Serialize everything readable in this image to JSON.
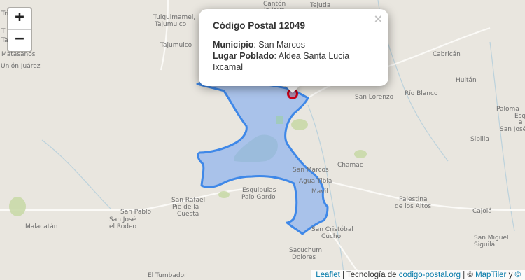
{
  "zoom": {
    "in_label": "+",
    "out_label": "−"
  },
  "popup": {
    "close_label": "×",
    "title": "Código Postal 12049",
    "municipio_label": "Municipio",
    "municipio_value": "San Marcos",
    "lugar_label": "Lugar Poblado",
    "lugar_value": "Aldea Santa Lucia Ixcamal"
  },
  "attribution": {
    "leaflet": "Leaflet",
    "sep": " | Tecnología de ",
    "site": "codigo-postal.org",
    "sep2": " | © ",
    "maptiler": "MapTiler",
    "sep3": " y ",
    "osm": "©"
  },
  "places": [
    "Cantón",
    "la Joya",
    "Tejutla",
    "Tuiquimamel,",
    "Tajumulco",
    "Tajumulco",
    "Tri",
    "Ti",
    "Tala",
    "Matasanos",
    "Unión Juárez",
    "Cabricán",
    "Huitán",
    "San Lorenzo",
    "Río Blanco",
    "Paloma",
    "Esquipulas",
    "a Bar",
    "San José",
    "Sibilia",
    "Chamac",
    "San Marcos",
    "Agua Tibia",
    "Mavil",
    "Esquipulas",
    "Palo Gordo",
    "San Rafael",
    "Pie de la",
    "Cuesta",
    "San Pablo",
    "Malacatán",
    "San José",
    "el Rodeo",
    "Palestina",
    "de los Altos",
    "Cajolá",
    "San Cristóbal",
    "Cucho",
    "San Miguel",
    "Siguilá",
    "Sacuchum",
    "Dolores",
    "El Tumbador"
  ],
  "colors": {
    "zone_fill": "#a5c0ea",
    "zone_stroke": "#3f88e8",
    "marker": "#d0021b"
  },
  "icons": {
    "marker": "map-pin-icon"
  }
}
